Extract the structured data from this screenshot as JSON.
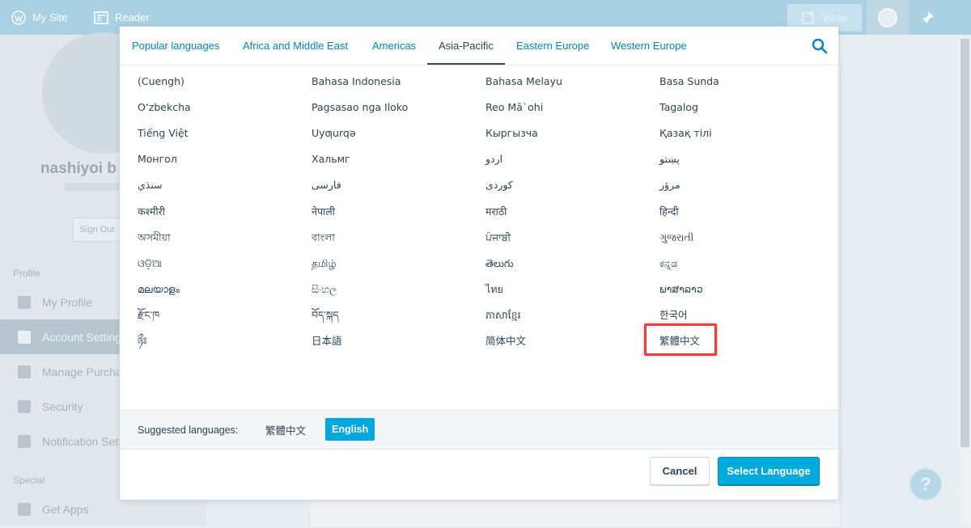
{
  "masterbar": {
    "my_site": "My Site",
    "reader": "Reader",
    "write": "Write"
  },
  "background": {
    "username": "nashiyoi b",
    "sign_out": "Sign Out",
    "section_profile": "Profile",
    "section_special": "Special",
    "nav": [
      {
        "label": "My Profile",
        "icon": "person-icon"
      },
      {
        "label": "Account Settings",
        "icon": "gear-icon"
      },
      {
        "label": "Manage Purchases",
        "icon": "card-icon"
      },
      {
        "label": "Security",
        "icon": "lock-icon"
      },
      {
        "label": "Notification Settings",
        "icon": "bell-icon"
      }
    ],
    "get_apps": "Get Apps",
    "help": "?"
  },
  "modal": {
    "tabs": [
      "Popular languages",
      "Africa and Middle East",
      "Americas",
      "Asia-Pacific",
      "Eastern Europe",
      "Western Europe"
    ],
    "active_tab": "Asia-Pacific",
    "languages": [
      [
        "(Cuengh)",
        "Bahasa Indonesia",
        "Bahasa Melayu",
        "Basa Sunda"
      ],
      [
        "O‘zbekcha",
        "Pagsasao nga Iloko",
        "Reo Mā`ohi",
        "Tagalog"
      ],
      [
        "Tiếng Việt",
        "Uyƣurqə",
        "Кыргызча",
        "Қазақ тілі"
      ],
      [
        "Монгол",
        "Хальмг",
        "اردو",
        "پښتو"
      ],
      [
        "سنڌي",
        "فارسی",
        "کوردی",
        "مرؤر"
      ],
      [
        "कश्मीरी",
        "नेपाली",
        "मराठी",
        "हिन्दी"
      ],
      [
        "অসমীয়া",
        "বাংলা",
        "ਪੰਜਾਬੀ",
        "ગુજરાતી"
      ],
      [
        "ଓଡ଼ିଆ",
        "தமிழ்",
        "తెలుగు",
        "ಕನ್ನಡ"
      ],
      [
        "മലയാളം",
        "සිංහල",
        "ไทย",
        "ພາສາລາວ"
      ],
      [
        "རྫོང་ཁ",
        "བོད་སྐད",
        "ភាសាខ្មែរ",
        "한국어"
      ],
      [
        "ཉྀཿ",
        "日本語",
        "简体中文",
        "繁體中文"
      ]
    ],
    "highlighted_language": "繁體中文",
    "highlight_color": "#e8413f",
    "suggested_label": "Suggested languages:",
    "suggested": [
      "繁體中文",
      "English"
    ],
    "suggested_selected": "English",
    "cancel": "Cancel",
    "select": "Select Language",
    "accent_color": "#00aadc"
  }
}
